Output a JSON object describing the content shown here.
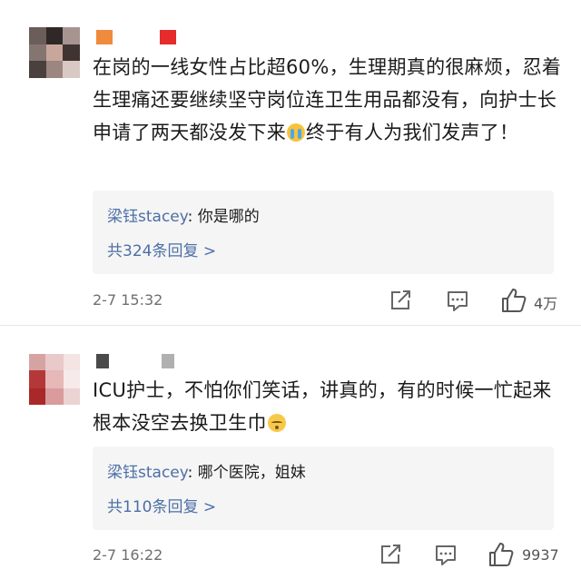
{
  "comments": [
    {
      "text": "在岗的一线女性占比超60%，生理期真的很麻烦，忍着生理痛还要继续坚守岗位连卫生用品都没有，向护士长申请了两天都没发下来",
      "text_tail": "终于有人为我们发声了！",
      "emoji": "loudly-crying-face",
      "reply": {
        "user": "梁钰stacey",
        "sep": ": ",
        "text": "你是哪的"
      },
      "reply_more": "共324条回复 >",
      "time": "2-7 15:32",
      "likes": "4万"
    },
    {
      "text": "ICU护士，不怕你们笑话，讲真的，有的时候一忙起来根本没空去换卫生巾",
      "text_tail": "",
      "emoji": "relieved-face",
      "reply": {
        "user": "梁钰stacey",
        "sep": ": ",
        "text": "哪个医院，姐妹"
      },
      "reply_more": "共110条回复 >",
      "time": "2-7 16:22",
      "likes": "9937"
    }
  ],
  "colors": {
    "link": "#4c6fa5",
    "meta": "#6f6f6f",
    "reply_bg": "#f5f5f5"
  }
}
